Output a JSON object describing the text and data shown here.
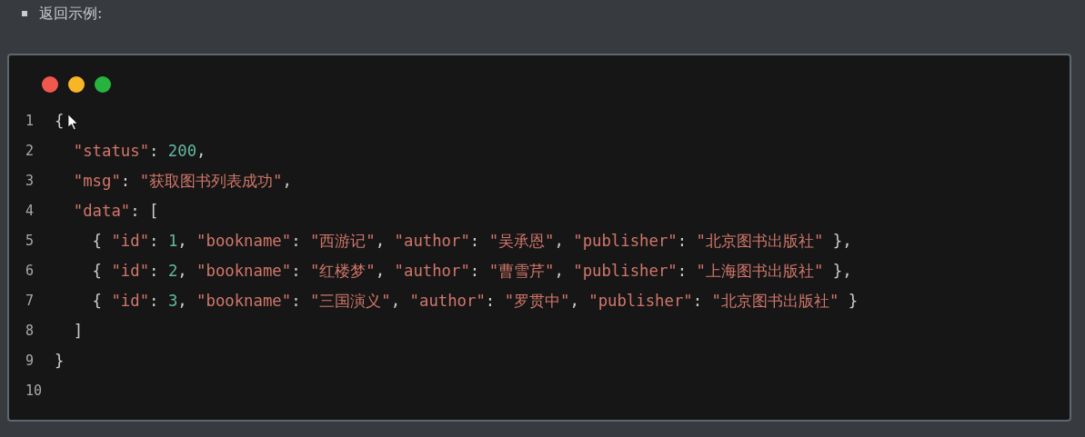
{
  "heading": {
    "text": "返回示例:"
  },
  "window_controls": [
    {
      "color": "#f0584e"
    },
    {
      "color": "#f8b526"
    },
    {
      "color": "#27b43e"
    }
  ],
  "code_lines": [
    {
      "number": "1",
      "tokens": [
        {
          "kind": "punct",
          "text": "{"
        }
      ]
    },
    {
      "number": "2",
      "tokens": [
        {
          "kind": "string",
          "text": "  \"status\""
        },
        {
          "kind": "punct",
          "text": ": "
        },
        {
          "kind": "number",
          "text": "200"
        },
        {
          "kind": "punct",
          "text": ","
        }
      ]
    },
    {
      "number": "3",
      "tokens": [
        {
          "kind": "string",
          "text": "  \"msg\""
        },
        {
          "kind": "punct",
          "text": ": "
        },
        {
          "kind": "string",
          "text": "\"获取图书列表成功\""
        },
        {
          "kind": "punct",
          "text": ","
        }
      ]
    },
    {
      "number": "4",
      "tokens": [
        {
          "kind": "string",
          "text": "  \"data\""
        },
        {
          "kind": "punct",
          "text": ": ["
        }
      ]
    },
    {
      "number": "5",
      "tokens": [
        {
          "kind": "punct",
          "text": "    { "
        },
        {
          "kind": "string",
          "text": "\"id\""
        },
        {
          "kind": "punct",
          "text": ": "
        },
        {
          "kind": "number",
          "text": "1"
        },
        {
          "kind": "punct",
          "text": ", "
        },
        {
          "kind": "string",
          "text": "\"bookname\""
        },
        {
          "kind": "punct",
          "text": ": "
        },
        {
          "kind": "string",
          "text": "\"西游记\""
        },
        {
          "kind": "punct",
          "text": ", "
        },
        {
          "kind": "string",
          "text": "\"author\""
        },
        {
          "kind": "punct",
          "text": ": "
        },
        {
          "kind": "string",
          "text": "\"吴承恩\""
        },
        {
          "kind": "punct",
          "text": ", "
        },
        {
          "kind": "string",
          "text": "\"publisher\""
        },
        {
          "kind": "punct",
          "text": ": "
        },
        {
          "kind": "string",
          "text": "\"北京图书出版社\""
        },
        {
          "kind": "punct",
          "text": " },"
        }
      ]
    },
    {
      "number": "6",
      "tokens": [
        {
          "kind": "punct",
          "text": "    { "
        },
        {
          "kind": "string",
          "text": "\"id\""
        },
        {
          "kind": "punct",
          "text": ": "
        },
        {
          "kind": "number",
          "text": "2"
        },
        {
          "kind": "punct",
          "text": ", "
        },
        {
          "kind": "string",
          "text": "\"bookname\""
        },
        {
          "kind": "punct",
          "text": ": "
        },
        {
          "kind": "string",
          "text": "\"红楼梦\""
        },
        {
          "kind": "punct",
          "text": ", "
        },
        {
          "kind": "string",
          "text": "\"author\""
        },
        {
          "kind": "punct",
          "text": ": "
        },
        {
          "kind": "string",
          "text": "\"曹雪芹\""
        },
        {
          "kind": "punct",
          "text": ", "
        },
        {
          "kind": "string",
          "text": "\"publisher\""
        },
        {
          "kind": "punct",
          "text": ": "
        },
        {
          "kind": "string",
          "text": "\"上海图书出版社\""
        },
        {
          "kind": "punct",
          "text": " },"
        }
      ]
    },
    {
      "number": "7",
      "tokens": [
        {
          "kind": "punct",
          "text": "    { "
        },
        {
          "kind": "string",
          "text": "\"id\""
        },
        {
          "kind": "punct",
          "text": ": "
        },
        {
          "kind": "number",
          "text": "3"
        },
        {
          "kind": "punct",
          "text": ", "
        },
        {
          "kind": "string",
          "text": "\"bookname\""
        },
        {
          "kind": "punct",
          "text": ": "
        },
        {
          "kind": "string",
          "text": "\"三国演义\""
        },
        {
          "kind": "punct",
          "text": ", "
        },
        {
          "kind": "string",
          "text": "\"author\""
        },
        {
          "kind": "punct",
          "text": ": "
        },
        {
          "kind": "string",
          "text": "\"罗贯中\""
        },
        {
          "kind": "punct",
          "text": ", "
        },
        {
          "kind": "string",
          "text": "\"publisher\""
        },
        {
          "kind": "punct",
          "text": ": "
        },
        {
          "kind": "string",
          "text": "\"北京图书出版社\""
        },
        {
          "kind": "punct",
          "text": " }"
        }
      ]
    },
    {
      "number": "8",
      "tokens": [
        {
          "kind": "punct",
          "text": "  ]"
        }
      ]
    },
    {
      "number": "9",
      "tokens": [
        {
          "kind": "punct",
          "text": "}"
        }
      ]
    },
    {
      "number": "10"
    }
  ]
}
